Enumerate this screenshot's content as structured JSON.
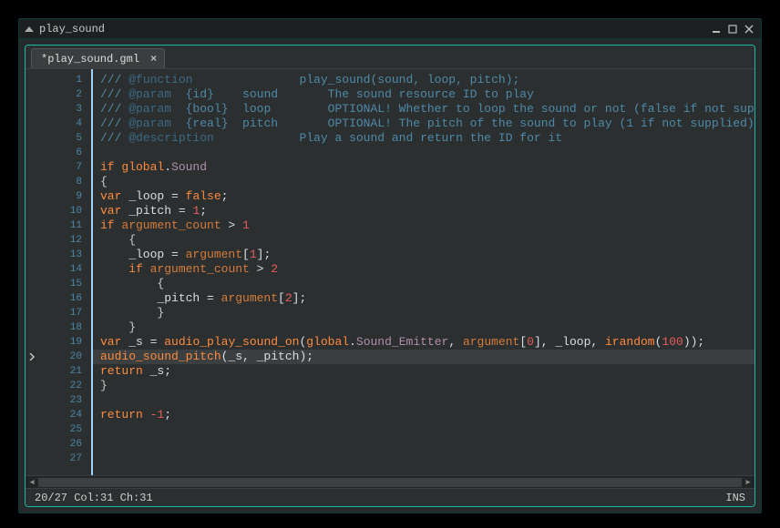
{
  "window": {
    "title": "play_sound"
  },
  "tab": {
    "label": "*play_sound.gml"
  },
  "status": {
    "pos": "20/27 Col:31 Ch:31",
    "mode": "INS"
  },
  "current_line": 20,
  "lines": [
    {
      "n": 1,
      "tokens": [
        {
          "t": "/// ",
          "c": "c-triple"
        },
        {
          "t": "@function",
          "c": "c-atparam"
        },
        {
          "t": "               play_sound(sound, loop, pitch);",
          "c": "c-triple"
        }
      ]
    },
    {
      "n": 2,
      "tokens": [
        {
          "t": "/// ",
          "c": "c-triple"
        },
        {
          "t": "@param",
          "c": "c-atparam"
        },
        {
          "t": "  {id}    sound       The sound resource ID to play",
          "c": "c-triple"
        }
      ]
    },
    {
      "n": 3,
      "tokens": [
        {
          "t": "/// ",
          "c": "c-triple"
        },
        {
          "t": "@param",
          "c": "c-atparam"
        },
        {
          "t": "  {bool}  loop        OPTIONAL! Whether to loop the sound or not (false if not supplied)",
          "c": "c-triple"
        }
      ]
    },
    {
      "n": 4,
      "tokens": [
        {
          "t": "/// ",
          "c": "c-triple"
        },
        {
          "t": "@param",
          "c": "c-atparam"
        },
        {
          "t": "  {real}  pitch       OPTIONAL! The pitch of the sound to play (1 if not supplied)",
          "c": "c-triple"
        }
      ]
    },
    {
      "n": 5,
      "tokens": [
        {
          "t": "/// ",
          "c": "c-triple"
        },
        {
          "t": "@description",
          "c": "c-atparam"
        },
        {
          "t": "            Play a sound and return the ID for it",
          "c": "c-triple"
        }
      ]
    },
    {
      "n": 6,
      "tokens": []
    },
    {
      "n": 7,
      "tokens": [
        {
          "t": "if ",
          "c": "c-kw"
        },
        {
          "t": "global",
          "c": "c-kw"
        },
        {
          "t": ".",
          "c": "c-var"
        },
        {
          "t": "Sound",
          "c": "c-prop"
        }
      ]
    },
    {
      "n": 8,
      "tokens": [
        {
          "t": "{",
          "c": "c-brace"
        }
      ]
    },
    {
      "n": 9,
      "tokens": [
        {
          "t": "var ",
          "c": "c-kw"
        },
        {
          "t": "_loop = ",
          "c": "c-var"
        },
        {
          "t": "false",
          "c": "c-kw"
        },
        {
          "t": ";",
          "c": "c-var"
        }
      ]
    },
    {
      "n": 10,
      "tokens": [
        {
          "t": "var ",
          "c": "c-kw"
        },
        {
          "t": "_pitch = ",
          "c": "c-var"
        },
        {
          "t": "1",
          "c": "c-num"
        },
        {
          "t": ";",
          "c": "c-var"
        }
      ]
    },
    {
      "n": 11,
      "tokens": [
        {
          "t": "if ",
          "c": "c-kw"
        },
        {
          "t": "argument_count",
          "c": "c-kw2"
        },
        {
          "t": " > ",
          "c": "c-var"
        },
        {
          "t": "1",
          "c": "c-num"
        }
      ]
    },
    {
      "n": 12,
      "tokens": [
        {
          "t": "    {",
          "c": "c-brace"
        }
      ]
    },
    {
      "n": 13,
      "tokens": [
        {
          "t": "    _loop = ",
          "c": "c-var"
        },
        {
          "t": "argument",
          "c": "c-kw2"
        },
        {
          "t": "[",
          "c": "c-var"
        },
        {
          "t": "1",
          "c": "c-num"
        },
        {
          "t": "];",
          "c": "c-var"
        }
      ]
    },
    {
      "n": 14,
      "tokens": [
        {
          "t": "    ",
          "c": "c-var"
        },
        {
          "t": "if ",
          "c": "c-kw"
        },
        {
          "t": "argument_count",
          "c": "c-kw2"
        },
        {
          "t": " > ",
          "c": "c-var"
        },
        {
          "t": "2",
          "c": "c-num"
        }
      ]
    },
    {
      "n": 15,
      "tokens": [
        {
          "t": "        {",
          "c": "c-brace"
        }
      ]
    },
    {
      "n": 16,
      "tokens": [
        {
          "t": "        _pitch = ",
          "c": "c-var"
        },
        {
          "t": "argument",
          "c": "c-kw2"
        },
        {
          "t": "[",
          "c": "c-var"
        },
        {
          "t": "2",
          "c": "c-num"
        },
        {
          "t": "];",
          "c": "c-var"
        }
      ]
    },
    {
      "n": 17,
      "tokens": [
        {
          "t": "        }",
          "c": "c-brace"
        }
      ]
    },
    {
      "n": 18,
      "tokens": [
        {
          "t": "    }",
          "c": "c-brace"
        }
      ]
    },
    {
      "n": 19,
      "tokens": [
        {
          "t": "var ",
          "c": "c-kw"
        },
        {
          "t": "_s = ",
          "c": "c-var"
        },
        {
          "t": "audio_play_sound_on",
          "c": "c-func"
        },
        {
          "t": "(",
          "c": "c-var"
        },
        {
          "t": "global",
          "c": "c-kw"
        },
        {
          "t": ".",
          "c": "c-var"
        },
        {
          "t": "Sound_Emitter",
          "c": "c-prop"
        },
        {
          "t": ", ",
          "c": "c-var"
        },
        {
          "t": "argument",
          "c": "c-kw2"
        },
        {
          "t": "[",
          "c": "c-var"
        },
        {
          "t": "0",
          "c": "c-num"
        },
        {
          "t": "], _loop, ",
          "c": "c-var"
        },
        {
          "t": "irandom",
          "c": "c-func"
        },
        {
          "t": "(",
          "c": "c-var"
        },
        {
          "t": "100",
          "c": "c-num"
        },
        {
          "t": "));",
          "c": "c-var"
        }
      ]
    },
    {
      "n": 20,
      "hl": true,
      "tokens": [
        {
          "t": "audio_sound_pitch",
          "c": "c-func"
        },
        {
          "t": "(_s, _pitch);",
          "c": "c-var"
        }
      ]
    },
    {
      "n": 21,
      "tokens": [
        {
          "t": "return ",
          "c": "c-kw"
        },
        {
          "t": "_s;",
          "c": "c-var"
        }
      ]
    },
    {
      "n": 22,
      "tokens": [
        {
          "t": "}",
          "c": "c-brace"
        }
      ]
    },
    {
      "n": 23,
      "tokens": []
    },
    {
      "n": 24,
      "tokens": [
        {
          "t": "return ",
          "c": "c-kw"
        },
        {
          "t": "-1",
          "c": "c-num"
        },
        {
          "t": ";",
          "c": "c-var"
        }
      ]
    },
    {
      "n": 25,
      "tokens": []
    },
    {
      "n": 26,
      "tokens": []
    },
    {
      "n": 27,
      "tokens": []
    }
  ]
}
